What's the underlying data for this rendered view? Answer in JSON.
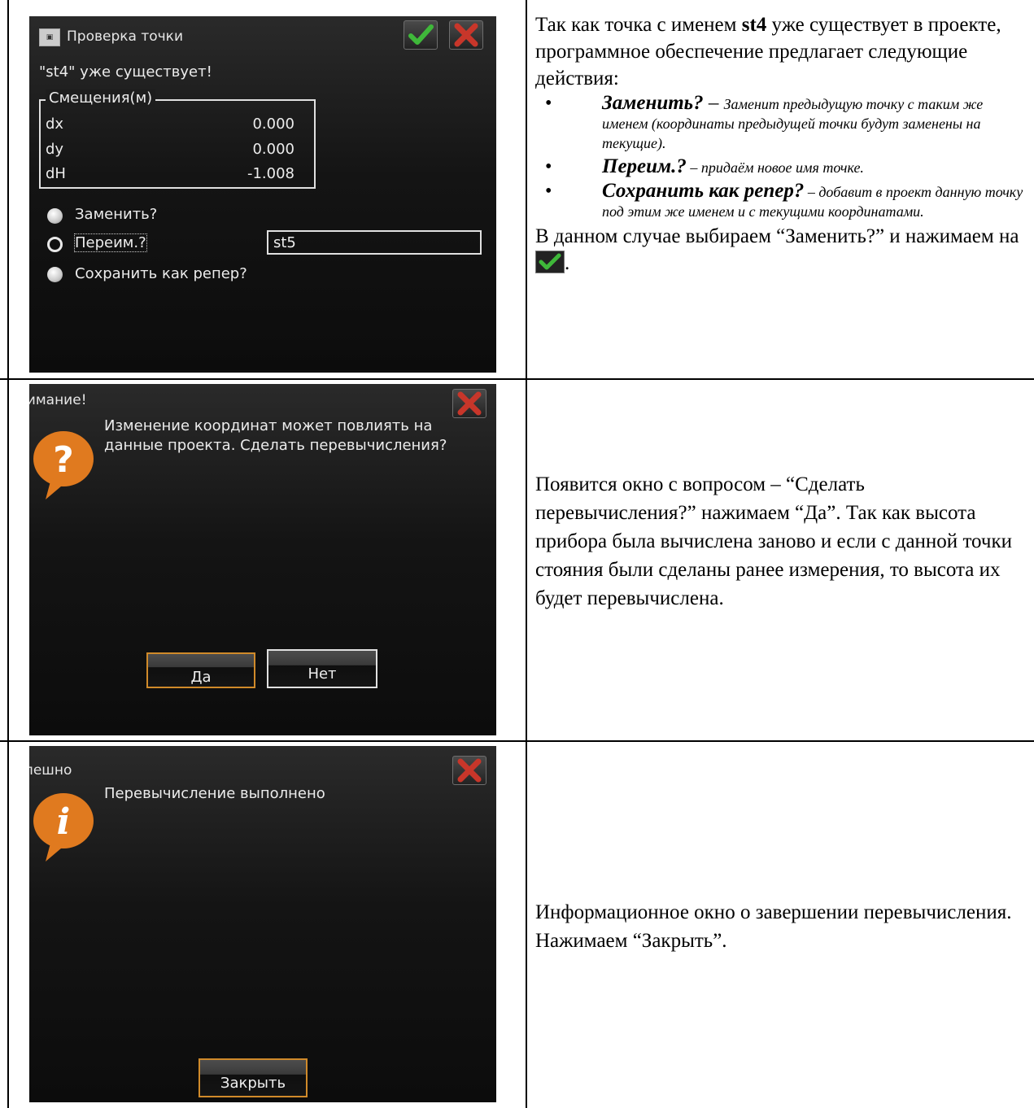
{
  "panel1": {
    "title": "Проверка точки",
    "title_icon": "app-icon",
    "exists_msg": "\"st4\" уже существует!",
    "offsets_label": "Смещения(м)",
    "offsets": [
      {
        "name": "dx",
        "value": "0.000"
      },
      {
        "name": "dy",
        "value": "0.000"
      },
      {
        "name": "dH",
        "value": "-1.008"
      }
    ],
    "options": [
      {
        "label": "Заменить?",
        "selected": false
      },
      {
        "label": "Переим.?",
        "selected": true
      },
      {
        "label": "Сохранить как репер?",
        "selected": false
      }
    ],
    "rename_value": "st5"
  },
  "desc1": {
    "intro_a": "Так как точка с именем ",
    "intro_name": "st4",
    "intro_b": " уже существует в проекте, программное обеспечение предлагает следующие действия:",
    "bullets": [
      {
        "term": "Заменить?",
        "sep": " – ",
        "text": "Заменит предыдущую точку с таким же именем (координаты предыдущей точки будут заменены на текущие)."
      },
      {
        "term": "Переим.?",
        "sep": " – ",
        "text": "придаём новое имя точке."
      },
      {
        "term": "Сохранить как репер?",
        "sep": " – ",
        "text": "добавит в проект данную точку под этим же именем и с текущими координатами."
      }
    ],
    "outro_a": "В данном случае выбираем “Заменить?” и нажимаем на ",
    "outro_b": "."
  },
  "panel2": {
    "title": "Внимание!",
    "message": "Изменение координат может повлиять на данные проекта. Сделать перевычисления?",
    "yes_label": "Да",
    "no_label": "Нет"
  },
  "desc2": {
    "text": "Появится окно с вопросом – “Сделать перевычисления?” нажимаем “Да”. Так как высота прибора была вычислена заново и если с данной точки стояния были сделаны ранее измерения, то высота их будет перевычислена."
  },
  "panel3": {
    "title": "Успешно",
    "message": "Перевычисление выполнено",
    "close_label": "Закрыть"
  },
  "desc3": {
    "text": "Информационное окно о завершении перевычисления. Нажимаем “Закрыть”."
  },
  "colors": {
    "accent_check": "#3fb83a",
    "accent_close": "#c8362a",
    "focus_border": "#d08a2a",
    "bubble": "#e07a1f"
  }
}
